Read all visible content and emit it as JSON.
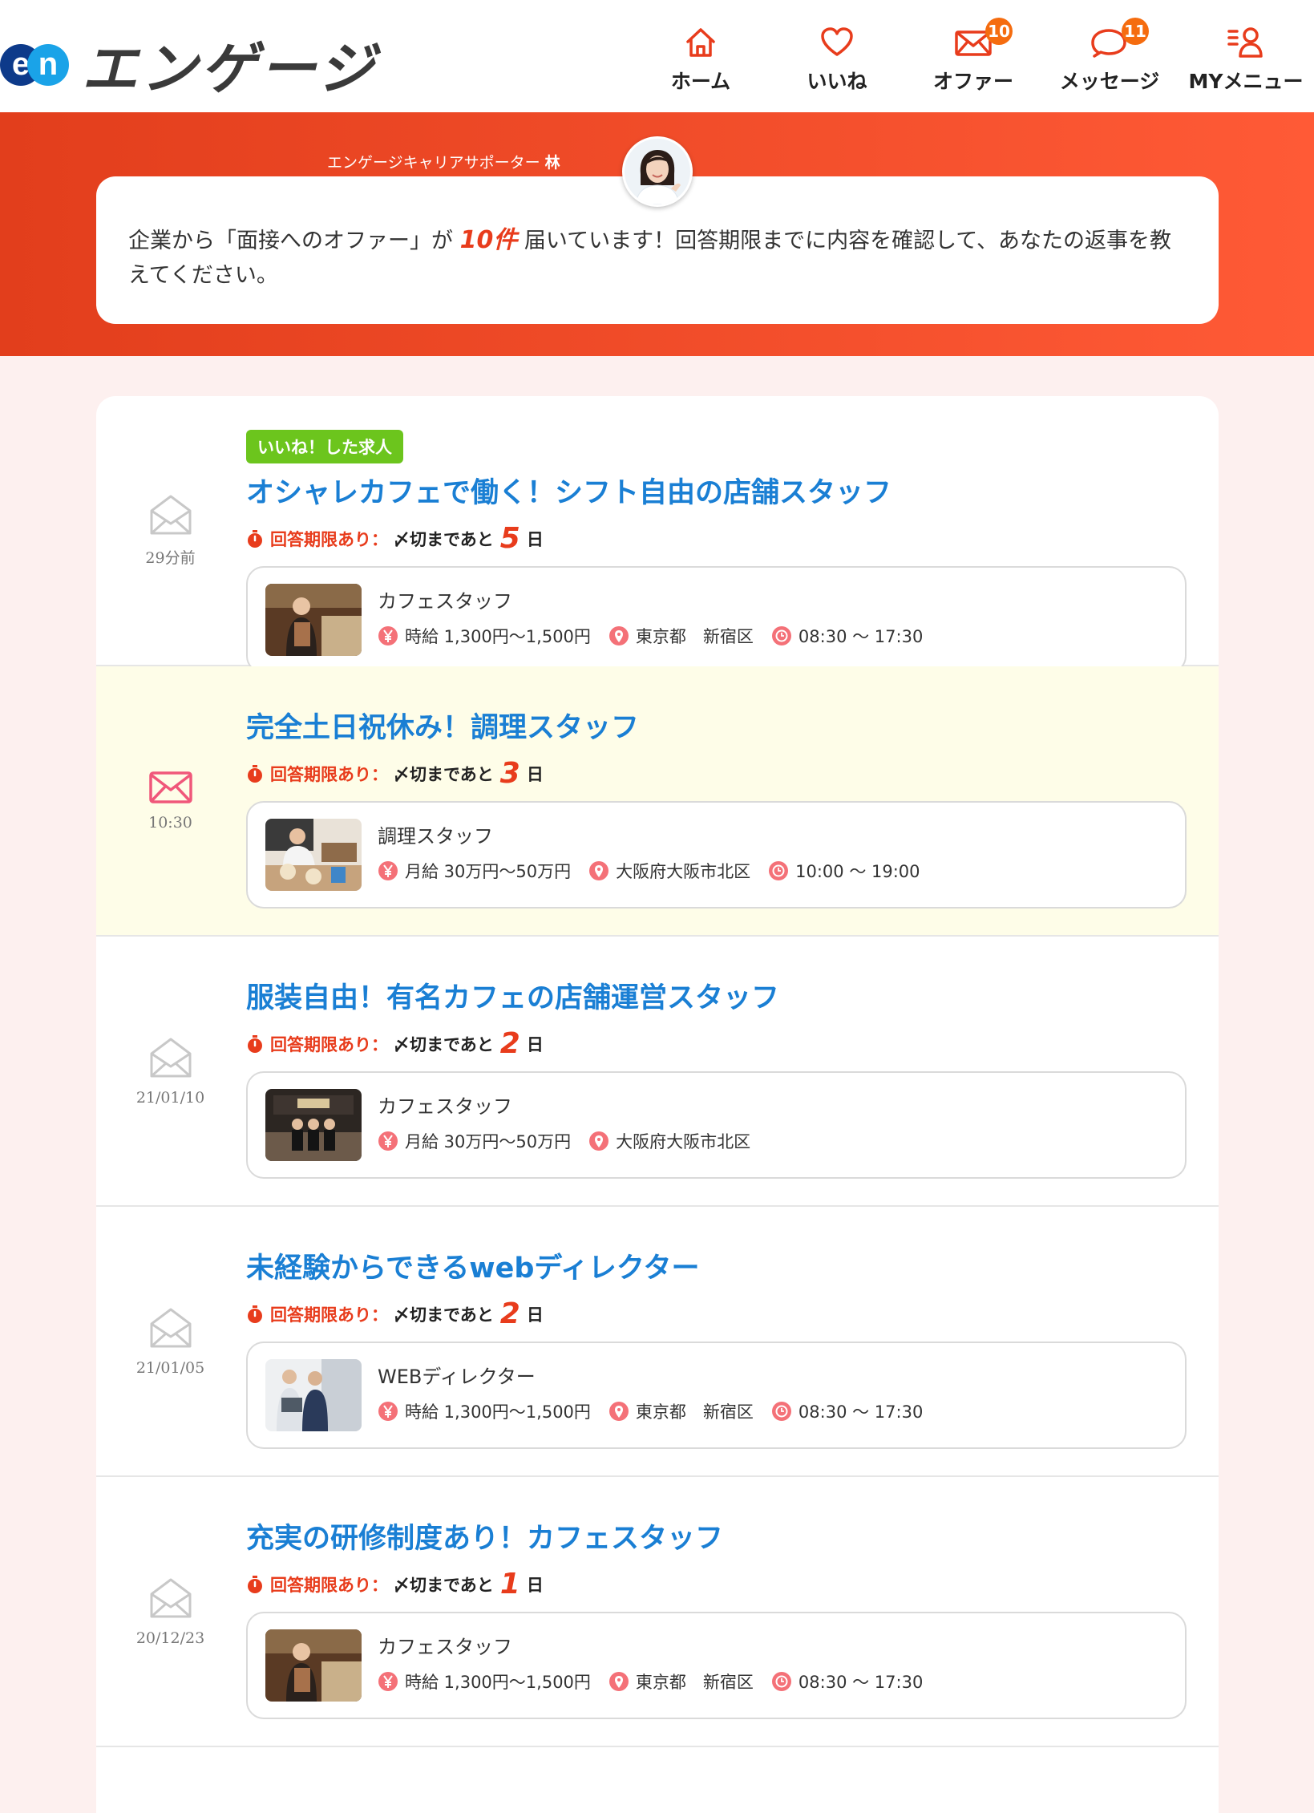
{
  "header": {
    "logo_mark_left": "e",
    "logo_mark_right": "n",
    "logo_text": "エンゲージ",
    "nav": [
      {
        "label": "ホーム",
        "icon": "home-icon",
        "badge": ""
      },
      {
        "label": "いいね",
        "icon": "heart-icon",
        "badge": ""
      },
      {
        "label": "オファー",
        "icon": "mail-icon",
        "badge": "10"
      },
      {
        "label": "メッセージ",
        "icon": "chat-icon",
        "badge": "11"
      },
      {
        "label": "MYメニュー",
        "icon": "user-menu-icon",
        "badge": ""
      }
    ]
  },
  "banner": {
    "supporter_prefix": "エンゲージキャリアサポーター",
    "supporter_name": "林",
    "message_before": "企業から「面接へのオファー」が ",
    "message_count": "10件",
    "message_after": " 届いています！回答期限までに内容を確認して、あなたの返事を教えてください。"
  },
  "colors": {
    "accent": "#e83c1c",
    "title_blue": "#1a7fd4",
    "tag_green": "#6cc51d",
    "badge_orange": "#f56c0f"
  },
  "offers": [
    {
      "tag": "いいね！した求人",
      "title": "オシャレカフェで働く！シフト自由の店舗スタッフ",
      "time": "29分前",
      "unread": false,
      "deadline_label": "回答期限あり：",
      "deadline_rest": "〆切まであと",
      "days": "5",
      "days_unit": "日",
      "job": "カフェスタッフ",
      "salary": "時給 1,300円〜1,500円",
      "location": "東京都　新宿区",
      "hours": "08:30 〜 17:30"
    },
    {
      "tag": "",
      "title": "完全土日祝休み！調理スタッフ",
      "time": "10:30",
      "unread": true,
      "deadline_label": "回答期限あり：",
      "deadline_rest": "〆切まであと",
      "days": "3",
      "days_unit": "日",
      "job": "調理スタッフ",
      "salary": "月給 30万円〜50万円",
      "location": "大阪府大阪市北区",
      "hours": "10:00 〜 19:00"
    },
    {
      "tag": "",
      "title": "服装自由！有名カフェの店舗運営スタッフ",
      "time": "21/01/10",
      "unread": false,
      "deadline_label": "回答期限あり：",
      "deadline_rest": "〆切まであと",
      "days": "2",
      "days_unit": "日",
      "job": "カフェスタッフ",
      "salary": "月給 30万円〜50万円",
      "location": "大阪府大阪市北区",
      "hours": ""
    },
    {
      "tag": "",
      "title": "未経験からできるwebディレクター",
      "time": "21/01/05",
      "unread": false,
      "deadline_label": "回答期限あり：",
      "deadline_rest": "〆切まであと",
      "days": "2",
      "days_unit": "日",
      "job": "WEBディレクター",
      "salary": "時給 1,300円〜1,500円",
      "location": "東京都　新宿区",
      "hours": "08:30 〜 17:30"
    },
    {
      "tag": "",
      "title": "充実の研修制度あり！カフェスタッフ",
      "time": "20/12/23",
      "unread": false,
      "deadline_label": "回答期限あり：",
      "deadline_rest": "〆切まであと",
      "days": "1",
      "days_unit": "日",
      "job": "カフェスタッフ",
      "salary": "時給 1,300円〜1,500円",
      "location": "東京都　新宿区",
      "hours": "08:30 〜 17:30"
    }
  ]
}
